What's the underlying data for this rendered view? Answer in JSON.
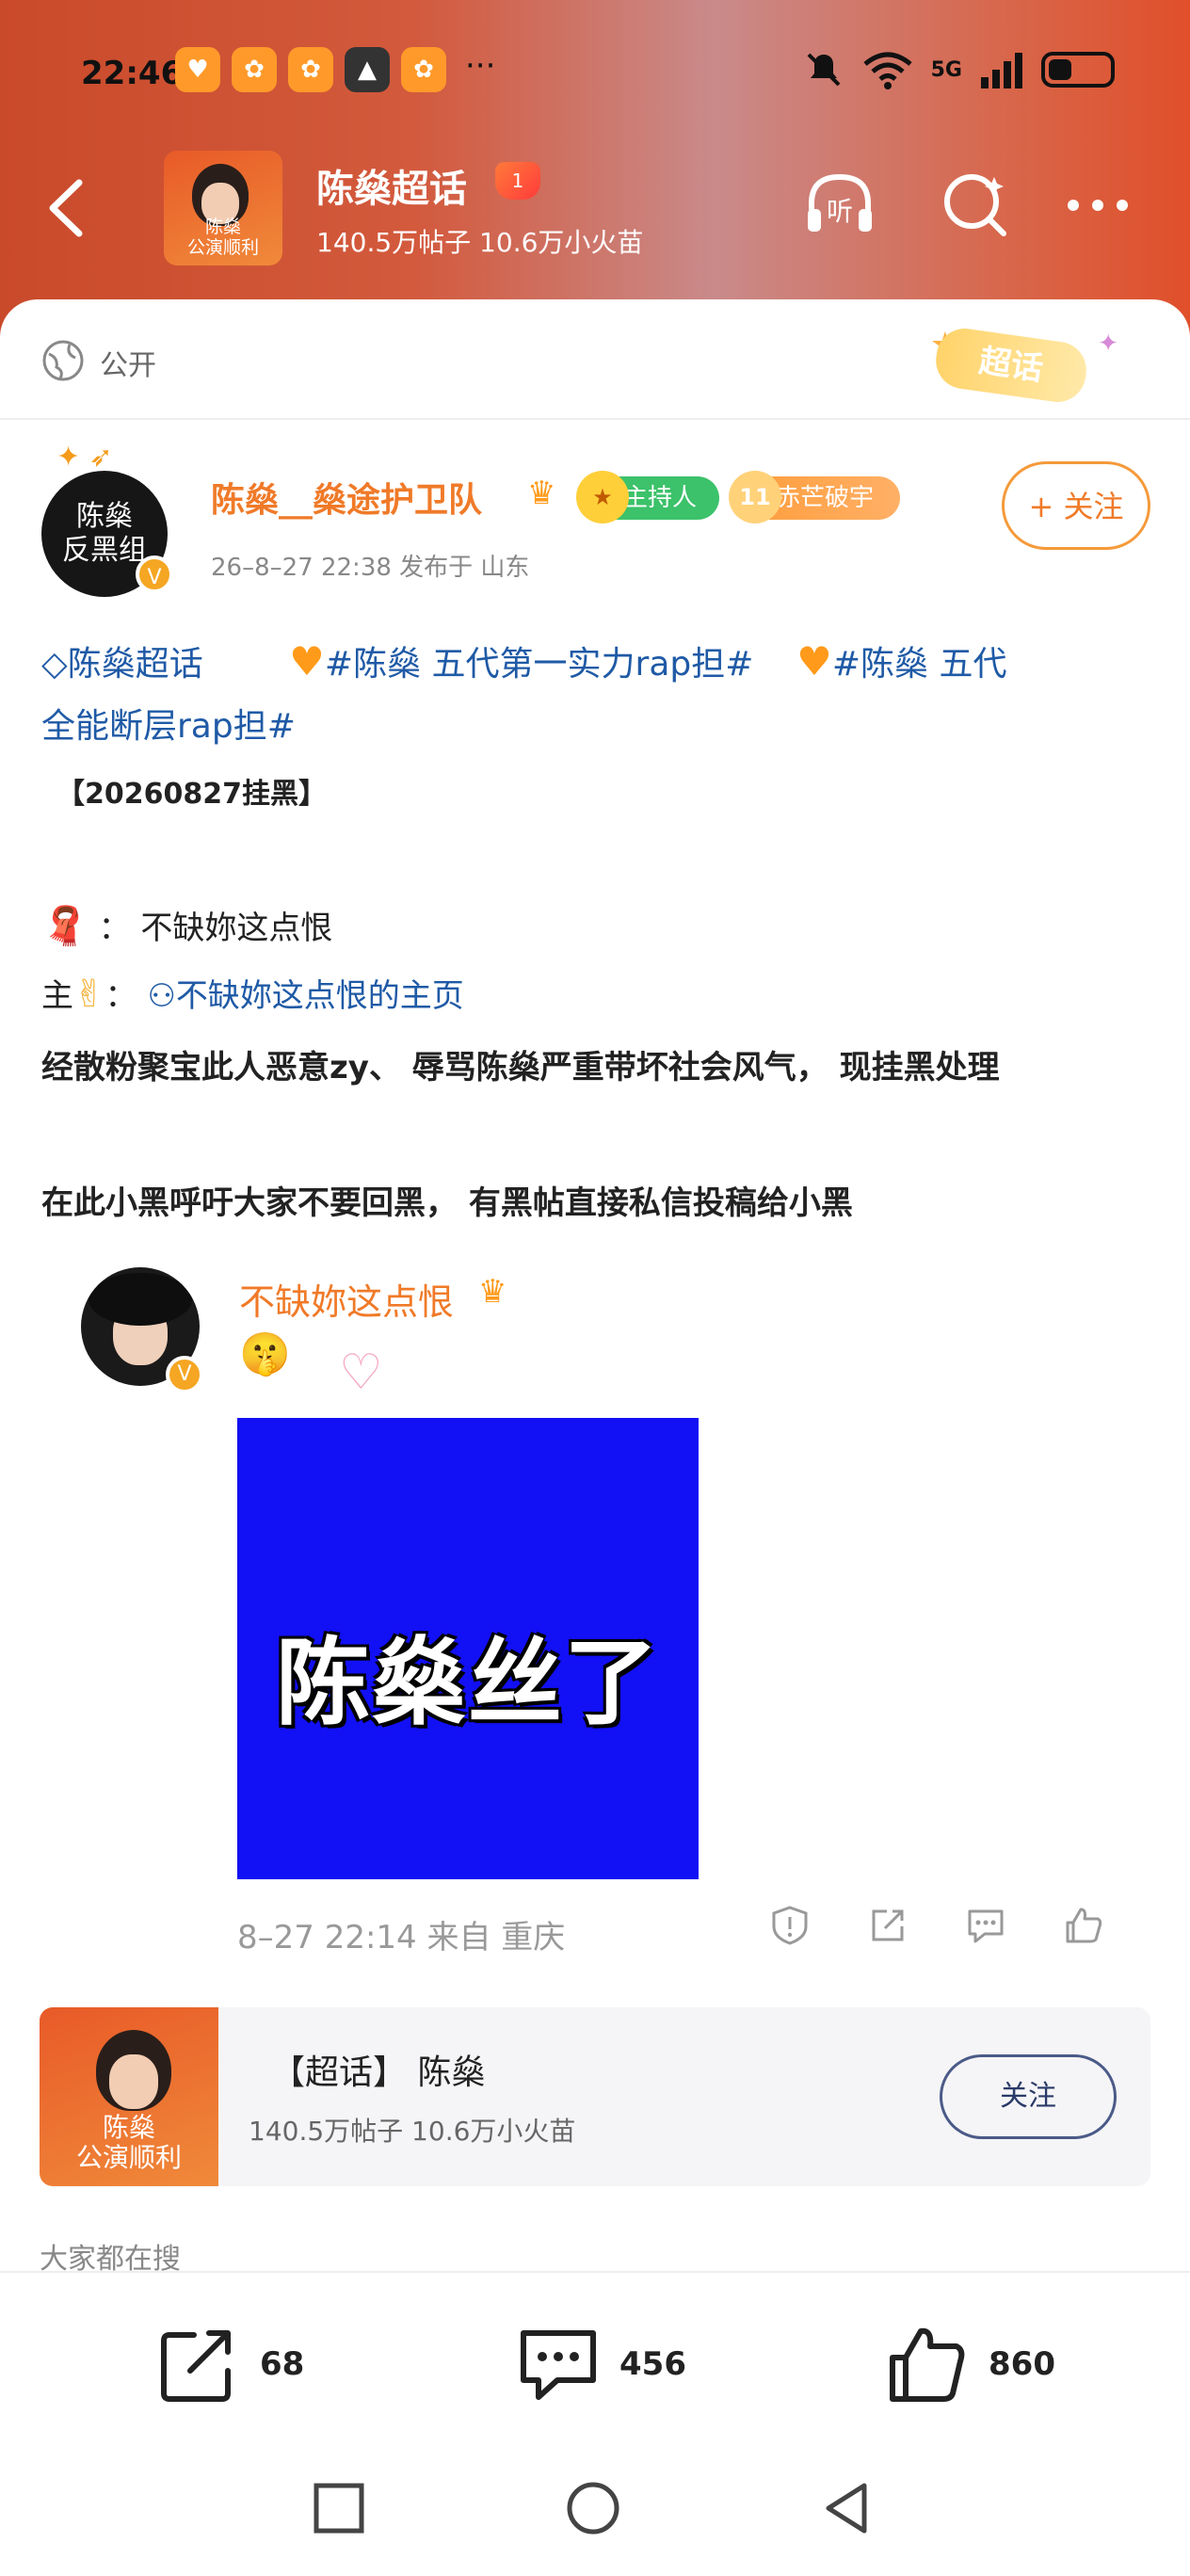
{
  "status_bar": {
    "time": "22:46",
    "notification_icons": [
      "app-icon",
      "app-icon",
      "app-icon",
      "image-icon",
      "app-icon"
    ],
    "more": "···",
    "signal_label": "5G",
    "wifi_label": "6"
  },
  "header": {
    "title": "陈燊超话",
    "level_badge": "1",
    "stats": "140.5万帖子  10.6万小火苗",
    "thumb_caption": "陈燊\n公演顺利",
    "listen_label": "听"
  },
  "visibility": {
    "label": "公开",
    "tag": "超话"
  },
  "author": {
    "avatar_text": "陈燊\n反黑组",
    "name": "陈燊__燊途护卫队",
    "crown_level": "5",
    "badge_host": "主持人",
    "badge_rank": "赤芒破宇",
    "badge_rank_level": "11",
    "meta": "26–8–27  22:38    发布于  山东",
    "follow_label": "+ 关注"
  },
  "post": {
    "tags_line1": "陈燊超话",
    "tag2": "#陈燊  五代第一实力rap担#",
    "tag3": "#陈燊  五代",
    "tags_line2": "全能断层rap担#",
    "title_line": "【20260827挂黑】",
    "line_scarf": "：  不缺妳这点恨",
    "line_main_label": "主",
    "line_main_link": "不缺妳这点恨的主页",
    "line_desc": "经散粉聚宝此人恶意zy、  辱骂陈燊严重带坏社会风气，  现挂黑处理",
    "line_appeal": "在此小黑呼吁大家不要回黑，  有黑帖直接私信投稿给小黑"
  },
  "repost": {
    "name": "不缺妳这点恨",
    "emoji": "🤫",
    "image_text": "陈燊丝了",
    "meta": "8–27 22:14 来自 重庆"
  },
  "topic_card": {
    "title": "【超话】 陈燊",
    "stats": "140.5万帖子   10.6万小火苗",
    "follow_label": "关注",
    "thumb_caption": "陈燊\n公演顺利"
  },
  "section_label": "大家都在搜",
  "bottom_bar": {
    "share_count": "68",
    "comment_count": "456",
    "like_count": "860"
  }
}
